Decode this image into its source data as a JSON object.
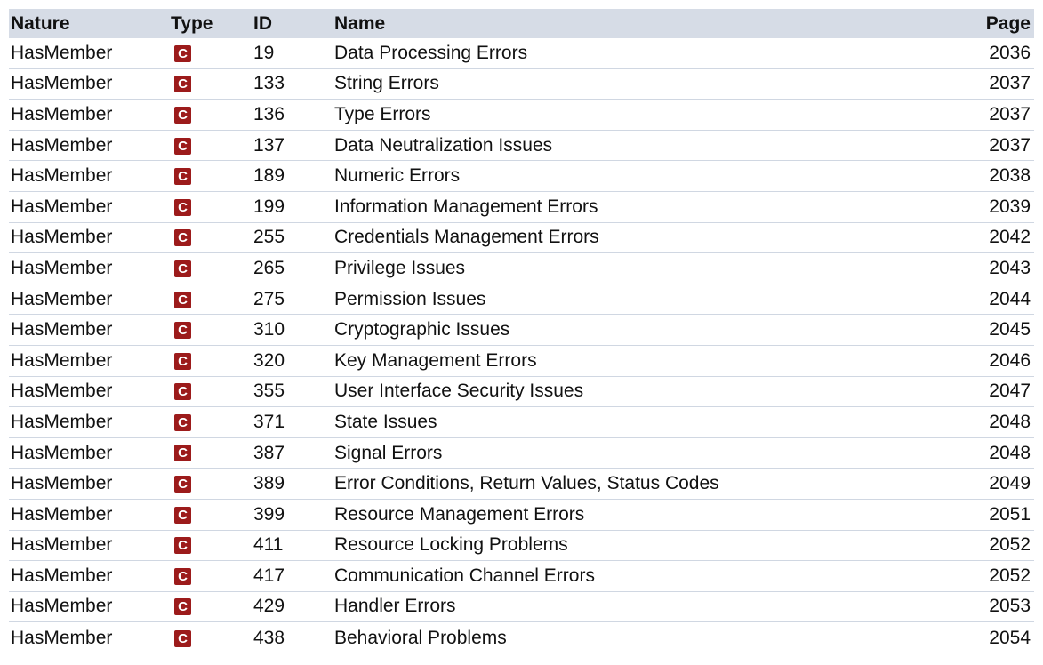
{
  "table": {
    "headers": {
      "nature": "Nature",
      "type": "Type",
      "id": "ID",
      "name": "Name",
      "page": "Page"
    },
    "type_icon": "category-icon",
    "type_icon_letter": "C",
    "type_icon_color": "#9c1b1b",
    "header_color": "#d6dce6",
    "rows": [
      {
        "nature": "HasMember",
        "type": "C",
        "id": "19",
        "name": "Data Processing Errors",
        "page": "2036"
      },
      {
        "nature": "HasMember",
        "type": "C",
        "id": "133",
        "name": "String Errors",
        "page": "2037"
      },
      {
        "nature": "HasMember",
        "type": "C",
        "id": "136",
        "name": "Type Errors",
        "page": "2037"
      },
      {
        "nature": "HasMember",
        "type": "C",
        "id": "137",
        "name": "Data Neutralization Issues",
        "page": "2037"
      },
      {
        "nature": "HasMember",
        "type": "C",
        "id": "189",
        "name": "Numeric Errors",
        "page": "2038"
      },
      {
        "nature": "HasMember",
        "type": "C",
        "id": "199",
        "name": "Information Management Errors",
        "page": "2039"
      },
      {
        "nature": "HasMember",
        "type": "C",
        "id": "255",
        "name": "Credentials Management Errors",
        "page": "2042"
      },
      {
        "nature": "HasMember",
        "type": "C",
        "id": "265",
        "name": "Privilege Issues",
        "page": "2043"
      },
      {
        "nature": "HasMember",
        "type": "C",
        "id": "275",
        "name": "Permission Issues",
        "page": "2044"
      },
      {
        "nature": "HasMember",
        "type": "C",
        "id": "310",
        "name": "Cryptographic Issues",
        "page": "2045"
      },
      {
        "nature": "HasMember",
        "type": "C",
        "id": "320",
        "name": "Key Management Errors",
        "page": "2046"
      },
      {
        "nature": "HasMember",
        "type": "C",
        "id": "355",
        "name": "User Interface Security Issues",
        "page": "2047"
      },
      {
        "nature": "HasMember",
        "type": "C",
        "id": "371",
        "name": "State Issues",
        "page": "2048"
      },
      {
        "nature": "HasMember",
        "type": "C",
        "id": "387",
        "name": "Signal Errors",
        "page": "2048"
      },
      {
        "nature": "HasMember",
        "type": "C",
        "id": "389",
        "name": "Error Conditions, Return Values, Status Codes",
        "page": "2049"
      },
      {
        "nature": "HasMember",
        "type": "C",
        "id": "399",
        "name": "Resource Management Errors",
        "page": "2051"
      },
      {
        "nature": "HasMember",
        "type": "C",
        "id": "411",
        "name": "Resource Locking Problems",
        "page": "2052"
      },
      {
        "nature": "HasMember",
        "type": "C",
        "id": "417",
        "name": "Communication Channel Errors",
        "page": "2052"
      },
      {
        "nature": "HasMember",
        "type": "C",
        "id": "429",
        "name": "Handler Errors",
        "page": "2053"
      },
      {
        "nature": "HasMember",
        "type": "C",
        "id": "438",
        "name": "Behavioral Problems",
        "page": "2054"
      }
    ]
  }
}
